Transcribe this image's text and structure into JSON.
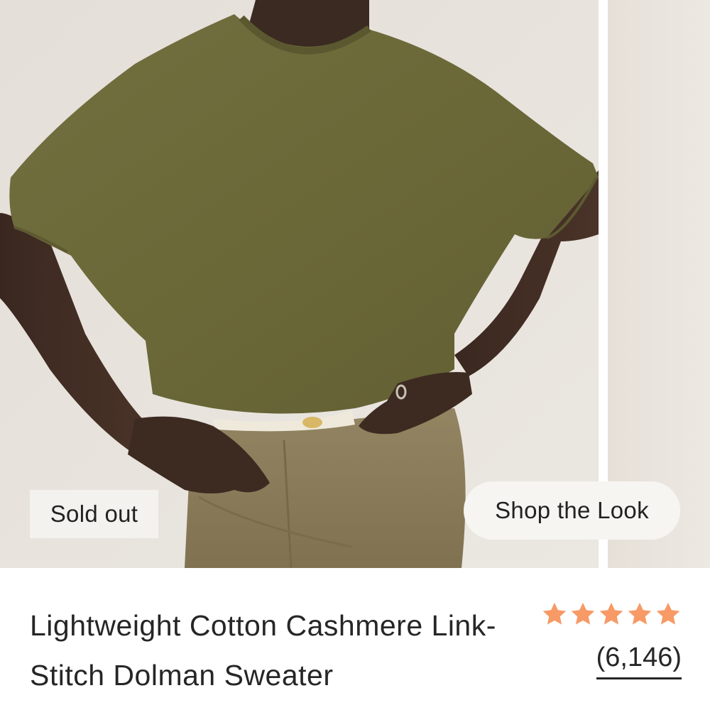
{
  "product": {
    "title": "Lightweight Cotton Cashmere Link-Stitch Dolman Sweater",
    "sold_out_label": "Sold out",
    "shop_look_label": "Shop the Look",
    "rating": {
      "stars": 5,
      "star_color": "#f79a66",
      "review_count": "(6,146)"
    },
    "sweater_color": "#6e6a3a",
    "pants_color": "#8b7d5a"
  },
  "icons": {
    "star": "star-icon"
  }
}
